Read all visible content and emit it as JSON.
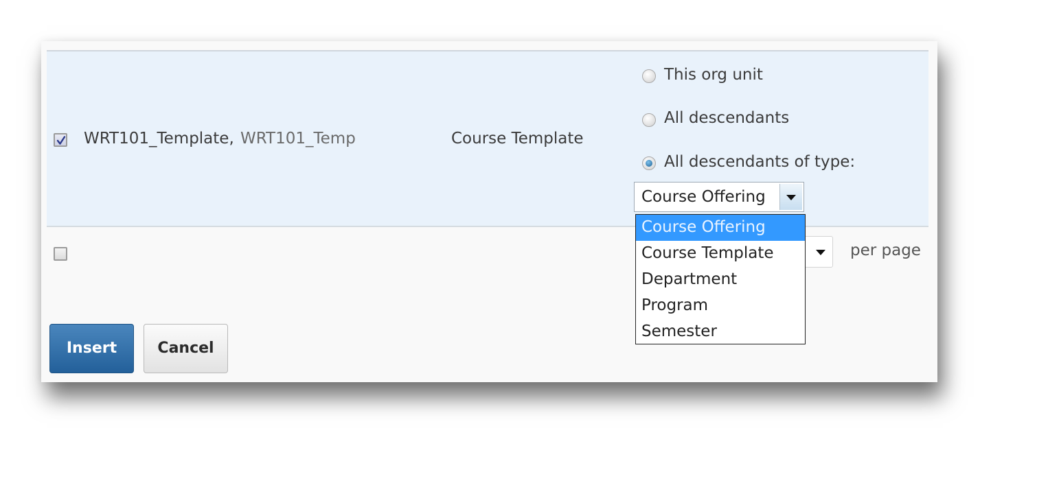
{
  "row": {
    "checked": true,
    "name": "WRT101_Template,",
    "code": "WRT101_Temp",
    "type": "Course Template",
    "scope_options": [
      {
        "label": "This org unit",
        "selected": false
      },
      {
        "label": "All descendants",
        "selected": false
      },
      {
        "label": "All descendants of type:",
        "selected": true
      }
    ],
    "type_select": {
      "value": "Course Offering",
      "open": true,
      "options": [
        "Course Offering",
        "Course Template",
        "Department",
        "Program",
        "Semester"
      ],
      "highlighted": "Course Offering"
    }
  },
  "footer": {
    "select_all_checked": false,
    "per_page_label": "per page"
  },
  "buttons": {
    "insert": "Insert",
    "cancel": "Cancel"
  },
  "colors": {
    "selected_row_bg": "#e9f2fb",
    "primary_button": "#2f6fa8",
    "dropdown_highlight": "#3399ff"
  }
}
